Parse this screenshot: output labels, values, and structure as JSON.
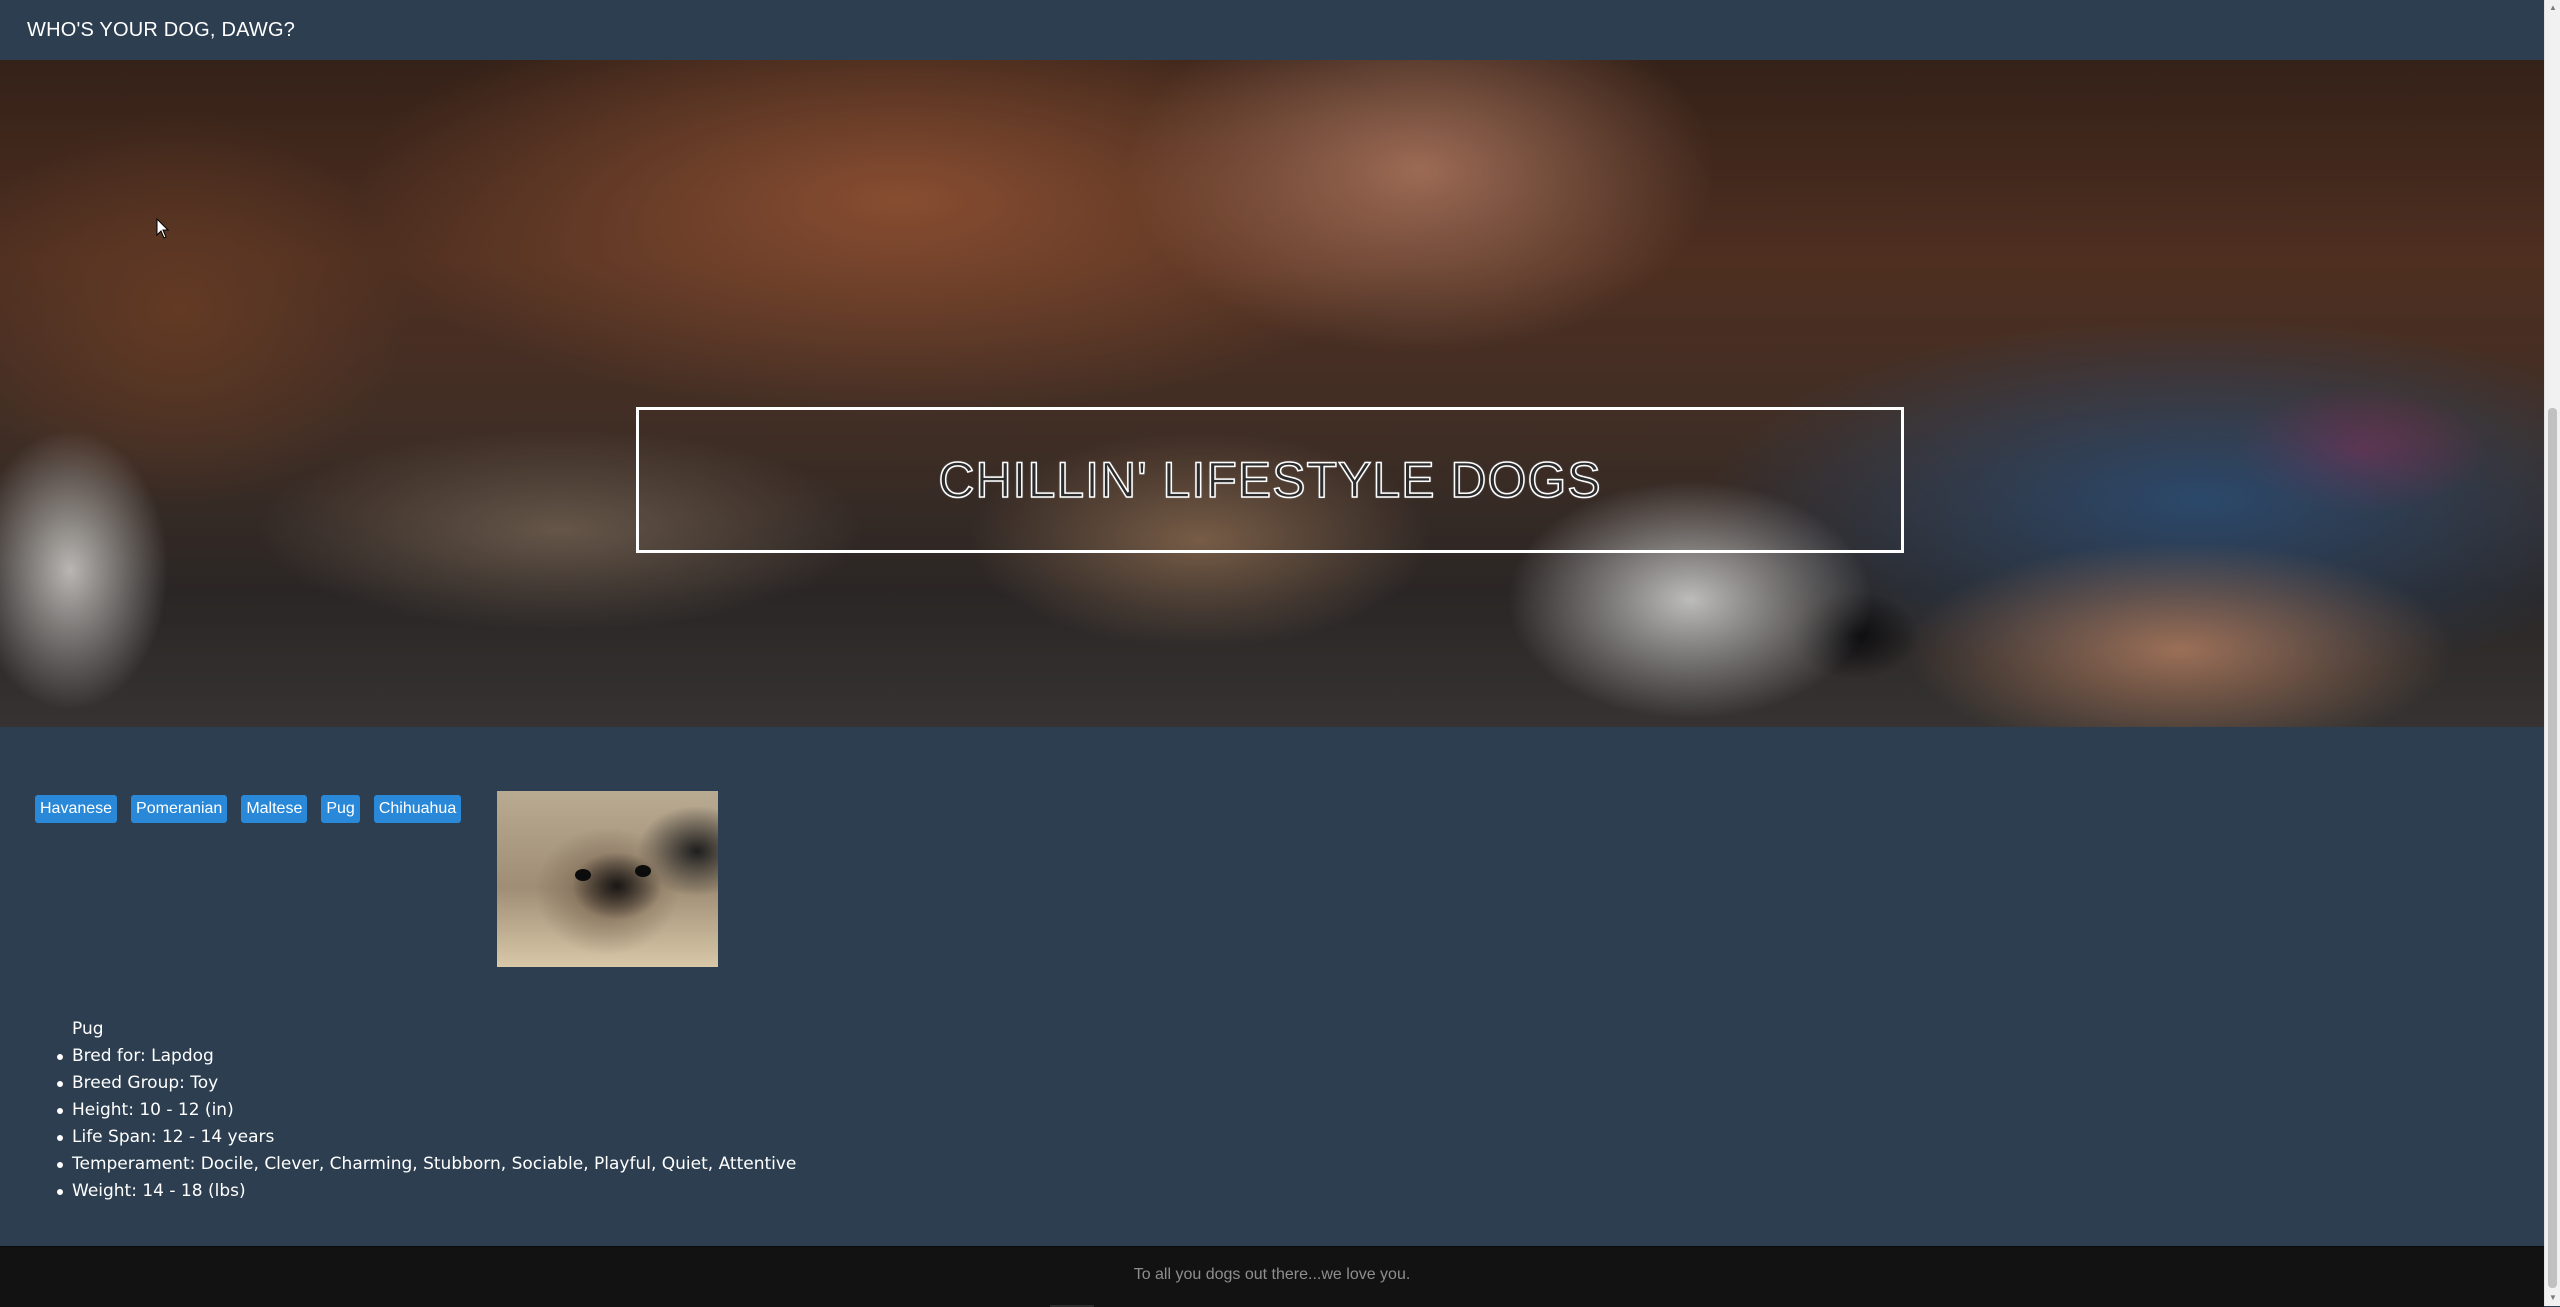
{
  "navbar": {
    "brand": "WHO'S YOUR DOG, DAWG?"
  },
  "hero": {
    "title": "CHILLIN' LIFESTYLE DOGS"
  },
  "breeds": [
    {
      "label": "Havanese"
    },
    {
      "label": "Pomeranian"
    },
    {
      "label": "Maltese"
    },
    {
      "label": "Pug"
    },
    {
      "label": "Chihuahua"
    }
  ],
  "selected_breed": {
    "name": "Pug",
    "details": [
      "Bred for: Lapdog",
      "Breed Group: Toy",
      "Height: 10 - 12 (in)",
      "Life Span: 12 - 14 years",
      "Temperament: Docile, Clever, Charming, Stubborn, Sociable, Playful, Quiet, Attentive",
      "Weight: 14 - 18 (lbs)"
    ]
  },
  "footer": {
    "text": "To all you dogs out there...we love you."
  },
  "colors": {
    "background": "#2c3e50",
    "button": "#2a88d8",
    "footer": "#121212"
  }
}
